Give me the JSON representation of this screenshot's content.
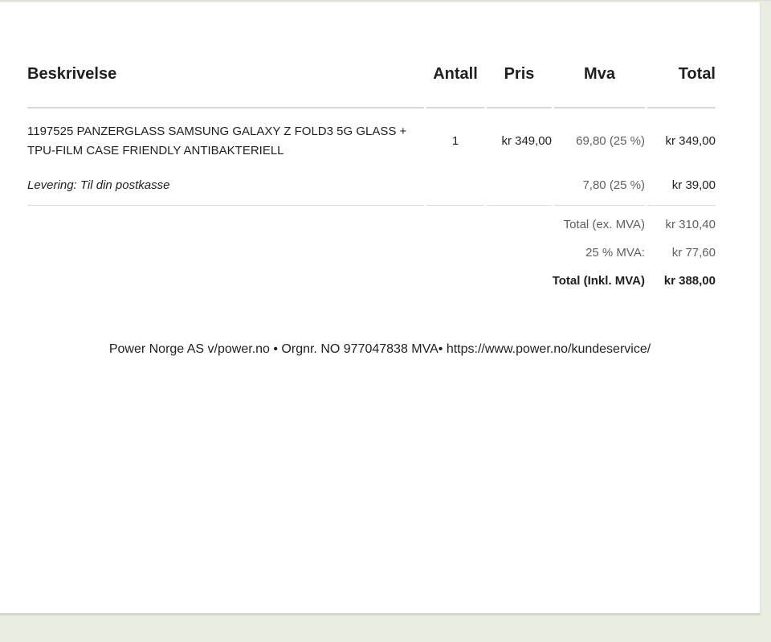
{
  "colors": {
    "background": "#e9eee0",
    "card": "#ffffff",
    "text": "#1f1f1f",
    "muted_text": "#5d5f61",
    "divider_line": "#d8d8d8"
  },
  "invoice": {
    "columns": {
      "description": "Beskrivelse",
      "quantity": "Antall",
      "price": "Pris",
      "vat": "Mva",
      "total": "Total"
    },
    "items": [
      {
        "description": "1197525 PANZERGLASS SAMSUNG GALAXY Z FOLD3 5G GLASS + TPU-FILM CASE FRIENDLY ANTIBAKTERIELL",
        "quantity": "1",
        "price": "kr 349,00",
        "vat": "69,80 (25 %)",
        "total": "kr 349,00"
      },
      {
        "description": "Levering: Til din postkasse",
        "quantity": "",
        "price": "",
        "vat": "7,80 (25 %)",
        "total": "kr 39,00"
      }
    ],
    "summary": [
      {
        "label": "Total (ex. MVA)",
        "value": "kr 310,40"
      },
      {
        "label": "25 % MVA:",
        "value": "kr 77,60"
      },
      {
        "label": "Total (Inkl. MVA)",
        "value": "kr 388,00"
      }
    ],
    "footer": "Power Norge AS v/power.no • Orgnr. NO 977047838 MVA• https://www.power.no/kundeservice/"
  }
}
